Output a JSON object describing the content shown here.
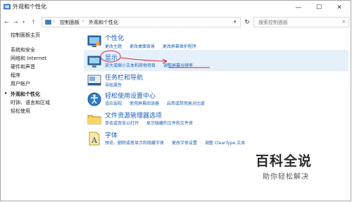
{
  "window": {
    "title": "外观和个性化",
    "controls": {
      "minimize": "—",
      "maximize": "☐",
      "close": "✕"
    }
  },
  "address": {
    "crumbs": [
      "控制面板",
      "外观和个性化"
    ],
    "search_placeholder": "搜索控制面板"
  },
  "left_nav": [
    {
      "label": "控制面板主页",
      "active": false
    },
    {
      "label": "系统和安全",
      "active": false
    },
    {
      "label": "网络和 Internet",
      "active": false
    },
    {
      "label": "硬件和声音",
      "active": false
    },
    {
      "label": "程序",
      "active": false
    },
    {
      "label": "用户帐户",
      "active": false
    },
    {
      "label": "外观和个性化",
      "active": true
    },
    {
      "label": "时钟、语言和区域",
      "active": false
    },
    {
      "label": "轻松使用",
      "active": false
    }
  ],
  "categories": [
    {
      "title": "个性化",
      "icon": "personalization-icon",
      "links": [
        "更改主题",
        "更改桌面背景",
        "更改屏幕保护程序"
      ]
    },
    {
      "title": "显示",
      "icon": "display-icon",
      "links": [
        "放大或缩小文本和其他项目",
        "调整屏幕分辨率"
      ]
    },
    {
      "title": "任务栏和导航",
      "icon": "taskbar-icon",
      "links": [
        "导航属性"
      ]
    },
    {
      "title": "轻松使用设置中心",
      "icon": "ease-of-access-icon",
      "links": [
        "适应弱视",
        "使用屏幕阅读器",
        "启用或禁用高对比度"
      ]
    },
    {
      "title": "文件资源管理器选项",
      "icon": "folder-options-icon",
      "links": [
        "单击或双击以打开",
        "显示隐藏的文件和文件夹"
      ]
    },
    {
      "title": "字体",
      "icon": "fonts-icon",
      "links": [
        "预览、删除或者显示和隐藏字体",
        "更改字体设置",
        "调整 ClearType 文本"
      ]
    }
  ],
  "watermark": {
    "title": "百科全说",
    "subtitle": "助你轻松解决"
  },
  "colors": {
    "link": "#1a5fb4",
    "highlight": "#e5f0fb",
    "annotation": "#e0243a"
  }
}
